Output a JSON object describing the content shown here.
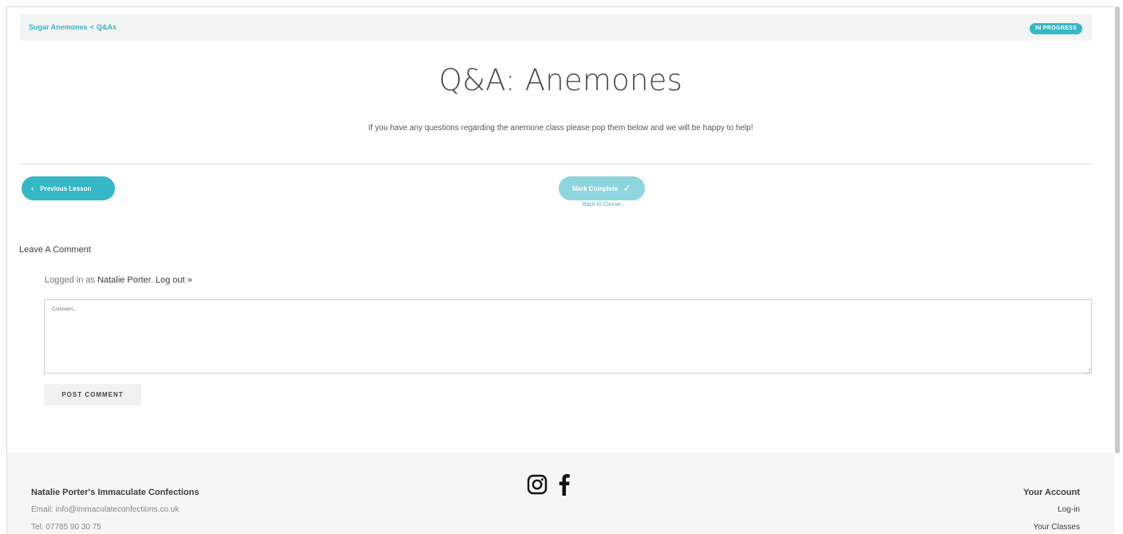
{
  "breadcrumb": {
    "course": "Sugar Anemones",
    "separator": "<",
    "current": "Q&As",
    "status": "IN PROGRESS"
  },
  "lesson": {
    "title": "Q&A: Anemones",
    "intro": "If you have any questions regarding the anemone class please pop them below and we will be happy to help!"
  },
  "nav": {
    "previous_label": "Previous Lesson",
    "complete_label": "Mark Complete",
    "back_label": "Back to Course"
  },
  "comments": {
    "heading": "Leave A Comment",
    "logged_prefix": "Logged in as",
    "user_name": "Natalie Porter",
    "logout_label": "Log out »",
    "placeholder": "Comment...",
    "submit_label": "POST COMMENT"
  },
  "footer": {
    "company": "Natalie Porter's Immaculate Confections",
    "email": "Email: info@immaculateconfections.co.uk",
    "tel": "Tel: 07785 90 30 75",
    "account_heading": "Your Account",
    "login_label": "Log-in",
    "classes_label": "Your Classes"
  },
  "colors": {
    "accent": "#36b7c5",
    "accent_light": "#8fd5dd"
  },
  "icons": [
    "chevron-left-icon",
    "checkmark-icon",
    "instagram-icon",
    "facebook-icon"
  ]
}
